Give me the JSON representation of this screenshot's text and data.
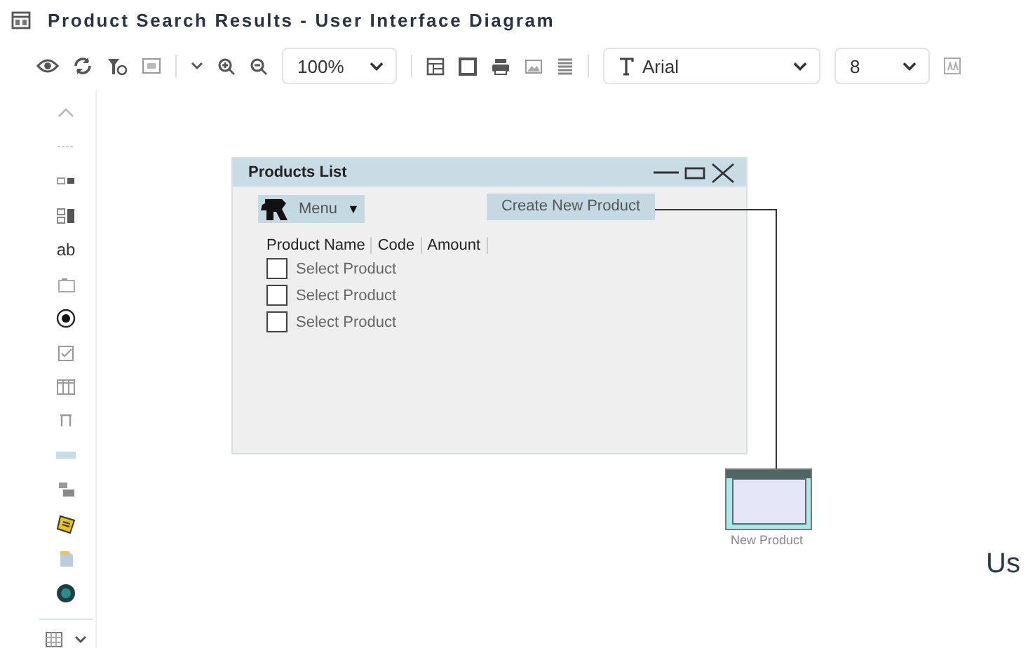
{
  "window": {
    "title": "Product Search Results - User Interface Diagram"
  },
  "palette": {
    "text_tool": "ab"
  },
  "toolbar": {
    "zoom": "100%",
    "font": "Arial",
    "font_size": "8"
  },
  "diagram": {
    "window": {
      "title": "Products List",
      "menu": "Menu",
      "menu_arrow": "▼",
      "button": "Create New Product",
      "columns": [
        "Product Name",
        "Code",
        "Amount"
      ],
      "rows": [
        {
          "label": "Select Product",
          "checked": false
        },
        {
          "label": "Select Product",
          "checked": false
        },
        {
          "label": "Select Product",
          "checked": false
        }
      ]
    },
    "node": {
      "label": "New Product"
    },
    "cut_text": "Us"
  }
}
